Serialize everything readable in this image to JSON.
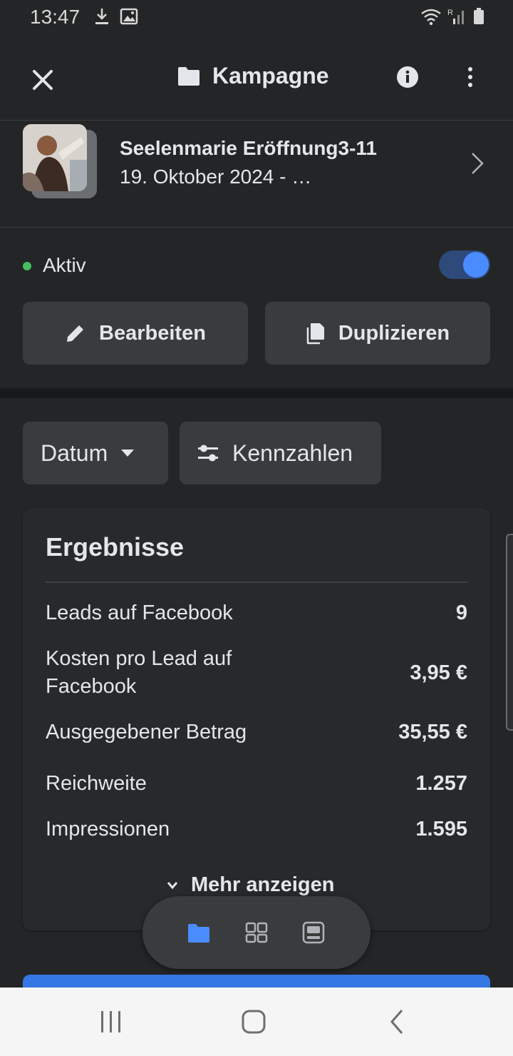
{
  "status_bar": {
    "time": "13:47"
  },
  "header": {
    "title": "Kampagne"
  },
  "campaign": {
    "name": "Seelenmarie Eröffnung3-11",
    "date": "19. Oktober 2024 - …"
  },
  "status": {
    "label": "Aktiv",
    "enabled": true
  },
  "actions": {
    "edit_label": "Bearbeiten",
    "duplicate_label": "Duplizieren"
  },
  "filters": {
    "date_label": "Datum",
    "metrics_label": "Kennzahlen"
  },
  "results": {
    "title": "Ergebnisse",
    "metrics": [
      {
        "label": "Leads auf Facebook",
        "value": "9"
      },
      {
        "label": "Kosten pro Lead auf Facebook",
        "value": "3,95 €"
      },
      {
        "label": "Ausgegebener Betrag",
        "value": "35,55 €"
      },
      {
        "label": "Reichweite",
        "value": "1.257"
      },
      {
        "label": "Impressionen",
        "value": "1.595"
      }
    ],
    "show_more_label": "Mehr anzeigen"
  },
  "colors": {
    "background": "#242526",
    "accent": "#4a8cff",
    "active_dot": "#45bd62"
  },
  "tab_bar": {
    "icons": [
      "folder-icon",
      "grid-icon",
      "ad-preview-icon"
    ],
    "active": 0
  }
}
